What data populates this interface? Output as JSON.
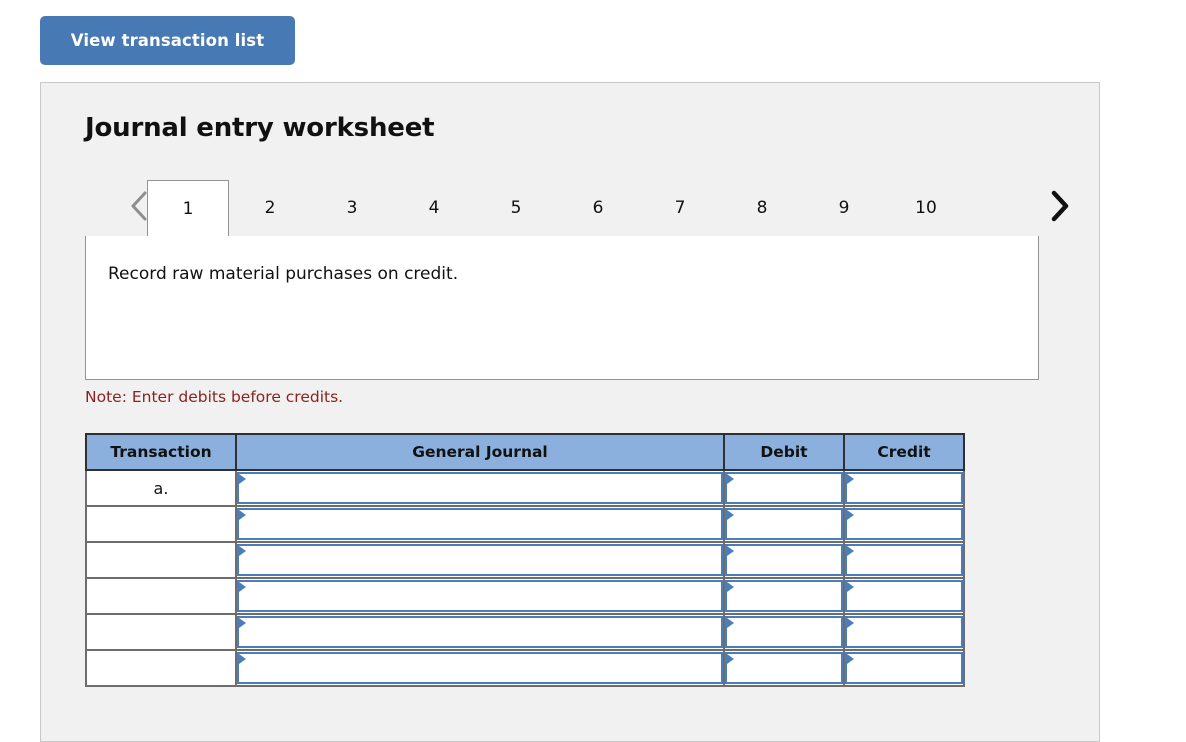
{
  "toolbar": {
    "view_transaction_list_label": "View transaction list"
  },
  "panel": {
    "title": "Journal entry worksheet",
    "nav": {
      "prev_icon": "chevron-left-icon",
      "next_icon": "chevron-right-icon",
      "prev_glyph": "‹",
      "next_glyph": "›"
    },
    "tabs": [
      {
        "label": "1",
        "active": true
      },
      {
        "label": "2",
        "active": false
      },
      {
        "label": "3",
        "active": false
      },
      {
        "label": "4",
        "active": false
      },
      {
        "label": "5",
        "active": false
      },
      {
        "label": "6",
        "active": false
      },
      {
        "label": "7",
        "active": false
      },
      {
        "label": "8",
        "active": false
      },
      {
        "label": "9",
        "active": false
      },
      {
        "label": "10",
        "active": false
      }
    ],
    "instruction": "Record raw material purchases on credit.",
    "note": "Note: Enter debits before credits."
  },
  "journal": {
    "columns": [
      "Transaction",
      "General Journal",
      "Debit",
      "Credit"
    ],
    "rows": [
      {
        "transaction": "a.",
        "general_journal": "",
        "debit": "",
        "credit": ""
      },
      {
        "transaction": "",
        "general_journal": "",
        "debit": "",
        "credit": ""
      },
      {
        "transaction": "",
        "general_journal": "",
        "debit": "",
        "credit": ""
      },
      {
        "transaction": "",
        "general_journal": "",
        "debit": "",
        "credit": ""
      },
      {
        "transaction": "",
        "general_journal": "",
        "debit": "",
        "credit": ""
      },
      {
        "transaction": "",
        "general_journal": "",
        "debit": "",
        "credit": ""
      }
    ]
  },
  "colors": {
    "button_blue": "#4779b5",
    "header_blue": "#8bb0de",
    "cell_border_blue": "#4a7ebb",
    "note_red": "#8c2222",
    "panel_bg": "#f1f1f1"
  }
}
